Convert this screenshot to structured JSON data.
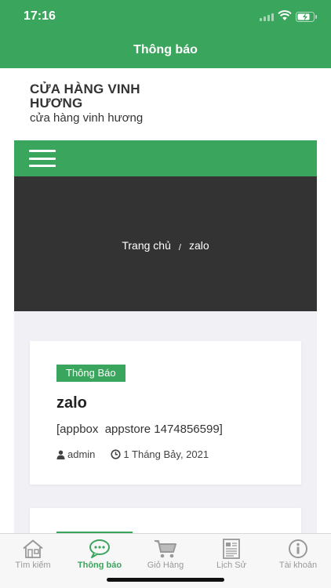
{
  "status_bar": {
    "time": "17:16"
  },
  "nav": {
    "title": "Thông báo"
  },
  "site": {
    "name": "CỬA HÀNG VINH HƯƠNG",
    "tagline": "cửa hàng vinh hương"
  },
  "breadcrumb": {
    "home": "Trang chủ",
    "separator": "/",
    "current": "zalo"
  },
  "posts": [
    {
      "category": "Thông Báo",
      "title": "zalo",
      "excerpt": "[appbox  appstore 1474856599]",
      "author": "admin",
      "date": "1 Tháng Bảy, 2021"
    },
    {
      "category": ""
    }
  ],
  "tabs": [
    {
      "label": "Tìm kiếm",
      "icon": "home-icon"
    },
    {
      "label": "Thông báo",
      "icon": "chat-bubble-icon",
      "active": true
    },
    {
      "label": "Giỏ Hàng",
      "icon": "cart-icon"
    },
    {
      "label": "Lịch Sử",
      "icon": "history-document-icon"
    },
    {
      "label": "Tài khoản",
      "icon": "info-icon"
    }
  ],
  "colors": {
    "accent": "#3aa55d",
    "hero_bg": "#333333",
    "content_bg": "#f1f1f5",
    "inactive_tab": "#999999"
  }
}
